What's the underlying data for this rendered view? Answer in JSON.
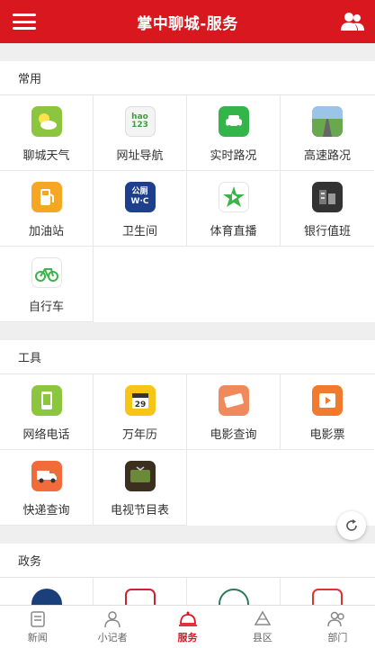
{
  "header": {
    "title": "掌中聊城-服务"
  },
  "sections": [
    {
      "title": "常用",
      "items": [
        {
          "label": "聊城天气",
          "icon": "weather-icon"
        },
        {
          "label": "网址导航",
          "icon": "hao123-icon",
          "icon_text": "hao\n123"
        },
        {
          "label": "实时路况",
          "icon": "traffic-icon"
        },
        {
          "label": "高速路况",
          "icon": "highway-icon"
        },
        {
          "label": "加油站",
          "icon": "gas-station-icon"
        },
        {
          "label": "卫生间",
          "icon": "toilet-icon",
          "icon_text": "公厕\nW·C"
        },
        {
          "label": "体育直播",
          "icon": "sports-live-icon"
        },
        {
          "label": "银行值班",
          "icon": "bank-icon"
        },
        {
          "label": "自行车",
          "icon": "bicycle-icon"
        }
      ]
    },
    {
      "title": "工具",
      "items": [
        {
          "label": "网络电话",
          "icon": "phone-icon"
        },
        {
          "label": "万年历",
          "icon": "calendar-icon"
        },
        {
          "label": "电影查询",
          "icon": "movie-ticket-icon"
        },
        {
          "label": "电影票",
          "icon": "movie-play-icon"
        },
        {
          "label": "快递查询",
          "icon": "express-icon"
        },
        {
          "label": "电视节目表",
          "icon": "tv-icon"
        }
      ]
    },
    {
      "title": "政务"
    }
  ],
  "tabs": [
    {
      "label": "新闻",
      "icon": "news-icon"
    },
    {
      "label": "小记者",
      "icon": "reporter-icon"
    },
    {
      "label": "服务",
      "icon": "service-icon",
      "active": true
    },
    {
      "label": "县区",
      "icon": "county-icon"
    },
    {
      "label": "部门",
      "icon": "department-icon"
    }
  ],
  "colors": {
    "brand": "#d9171f"
  }
}
